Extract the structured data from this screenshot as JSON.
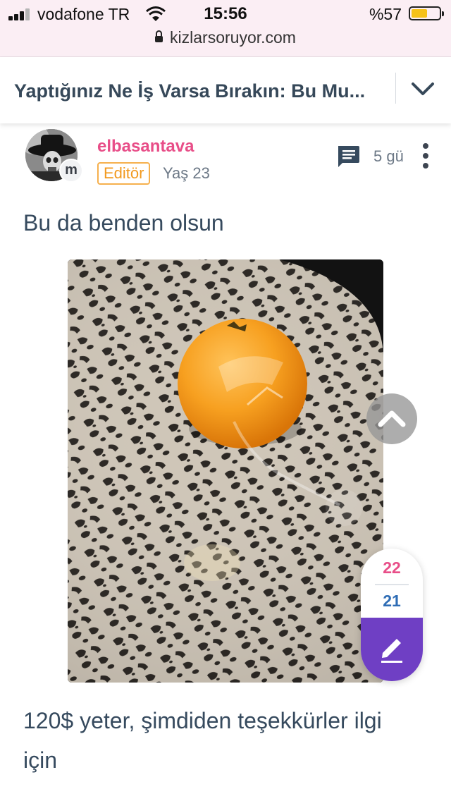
{
  "status_bar": {
    "carrier": "vodafone TR",
    "time": "15:56",
    "battery_percent": "%57",
    "battery_level": 0.57,
    "signal_bars": 3,
    "url": "kizlarsoruyor.com"
  },
  "question": {
    "title": "Yaptığınız Ne İş Varsa Bırakın: Bu Mu..."
  },
  "post": {
    "username": "elbasantava",
    "avatar_badge": "m",
    "role_badge": "Editör",
    "age": "Yaş 23",
    "time_ago": "5 gü",
    "text_before_image": "Bu da benden olsun",
    "text_after_image": "120$ yeter, şimdiden teşekkürler ilgi için"
  },
  "votes": {
    "up": "22",
    "down": "21"
  },
  "colors": {
    "username": "#e84e88",
    "editor_badge": "#f29a20",
    "vote_up": "#e84e88",
    "vote_down": "#2f6db5",
    "write_button": "#6f3fc4",
    "status_bar_bg": "#fbeef4"
  },
  "icons": {
    "signal": "signal-icon",
    "wifi": "wifi-icon",
    "lock": "lock-icon",
    "battery": "battery-icon",
    "chevron": "chevron-down-icon",
    "comment": "comment-icon",
    "more": "more-vertical-icon",
    "scroll_top": "chevron-up-icon",
    "write": "pencil-icon"
  }
}
